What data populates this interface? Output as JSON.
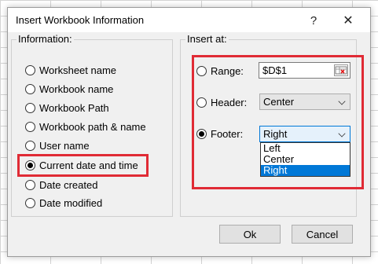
{
  "dialog": {
    "title": "Insert Workbook Information",
    "help": "?",
    "close": "✕"
  },
  "information": {
    "label": "Information:",
    "options": [
      {
        "label": "Worksheet name",
        "selected": false
      },
      {
        "label": "Workbook name",
        "selected": false
      },
      {
        "label": "Workbook Path",
        "selected": false
      },
      {
        "label": "Workbook path & name",
        "selected": false
      },
      {
        "label": "User name",
        "selected": false
      },
      {
        "label": "Current date and time",
        "selected": true
      },
      {
        "label": "Date created",
        "selected": false
      },
      {
        "label": "Date modified",
        "selected": false
      }
    ]
  },
  "insert_at": {
    "label": "Insert at:",
    "range": {
      "label": "Range:",
      "value": "$D$1",
      "selected": false
    },
    "header": {
      "label": "Header:",
      "value": "Center",
      "selected": false
    },
    "footer": {
      "label": "Footer:",
      "value": "Right",
      "selected": true
    },
    "footer_options": [
      "Left",
      "Center",
      "Right"
    ],
    "footer_highlighted": "Right"
  },
  "buttons": {
    "ok": "Ok",
    "cancel": "Cancel"
  },
  "colors": {
    "highlight": "#e02b35",
    "accent": "#0078d7"
  }
}
